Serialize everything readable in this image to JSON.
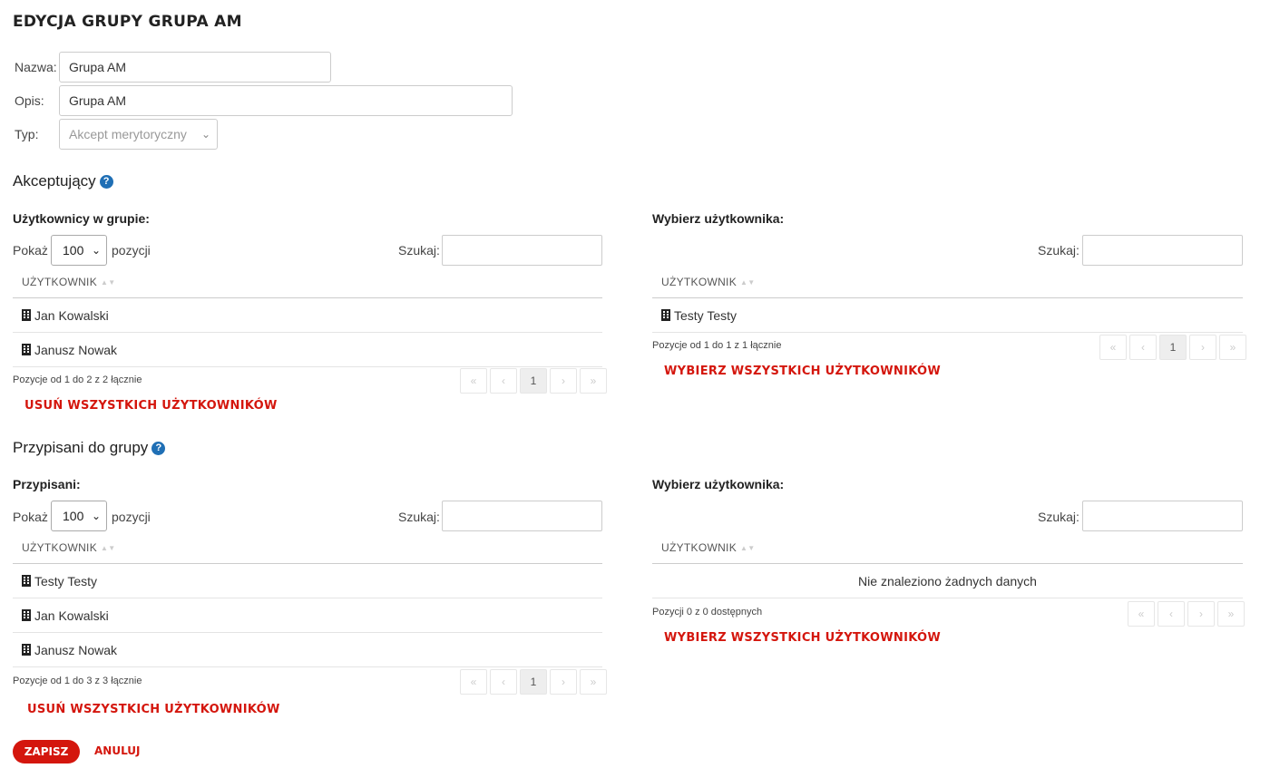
{
  "title": "EDYCJA GRUPY GRUPA AM",
  "form": {
    "name_label": "Nazwa:",
    "name_value": "Grupa AM",
    "desc_label": "Opis:",
    "desc_value": "Grupa AM",
    "type_label": "Typ:",
    "type_value": "Akcept merytoryczny"
  },
  "acceptors": {
    "heading": "Akceptujący",
    "left": {
      "subheading": "Użytkownicy w grupie:",
      "show_label": "Pokaż",
      "length_value": "100",
      "entries_label": "pozycji",
      "search_label": "Szukaj:",
      "column": "UŻYTKOWNIK",
      "rows": [
        "Jan Kowalski",
        "Janusz Nowak"
      ],
      "info": "Pozycje od 1 do 2 z 2 łącznie",
      "page": "1",
      "action": "USUŃ WSZYSTKICH UŻYTKOWNIKÓW"
    },
    "right": {
      "subheading": "Wybierz użytkownika:",
      "search_label": "Szukaj:",
      "column": "UŻYTKOWNIK",
      "rows": [
        "Testy Testy"
      ],
      "info": "Pozycje od 1 do 1 z 1 łącznie",
      "page": "1",
      "action": "WYBIERZ WSZYSTKICH UŻYTKOWNIKÓW"
    }
  },
  "assigned": {
    "heading": "Przypisani do grupy",
    "left": {
      "subheading": "Przypisani:",
      "show_label": "Pokaż",
      "length_value": "100",
      "entries_label": "pozycji",
      "search_label": "Szukaj:",
      "column": "UŻYTKOWNIK",
      "rows": [
        "Testy Testy",
        "Jan Kowalski",
        "Janusz Nowak"
      ],
      "info": "Pozycje od 1 do 3 z 3 łącznie",
      "page": "1",
      "action": "USUŃ WSZYSTKICH UŻYTKOWNIKÓW"
    },
    "right": {
      "subheading": "Wybierz użytkownika:",
      "search_label": "Szukaj:",
      "column": "UŻYTKOWNIK",
      "empty": "Nie znaleziono żadnych danych",
      "info": "Pozycji 0 z 0 dostępnych",
      "action": "WYBIERZ WSZYSTKICH UŻYTKOWNIKÓW"
    }
  },
  "pager_glyphs": {
    "first": "«",
    "prev": "‹",
    "next": "›",
    "last": "»"
  },
  "buttons": {
    "save": "ZAPISZ",
    "cancel": "ANULUJ"
  },
  "colors": {
    "accent": "#d4160d",
    "help": "#1f6fb5"
  }
}
